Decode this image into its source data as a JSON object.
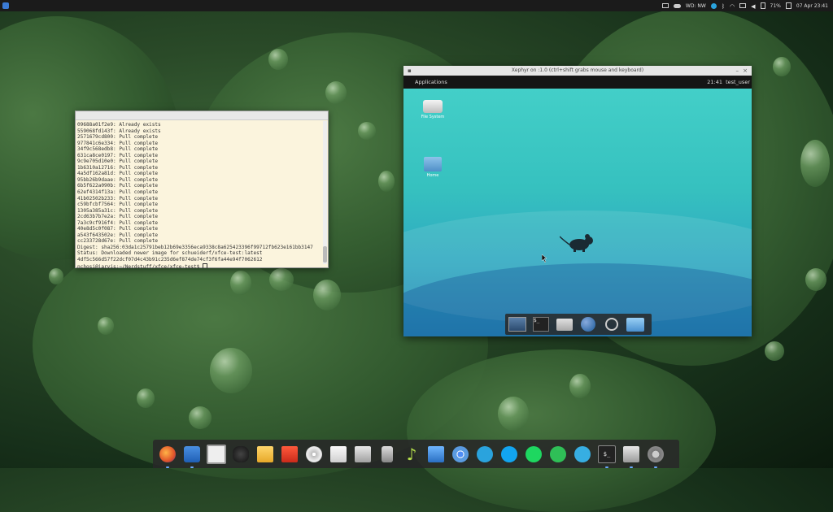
{
  "top_panel": {
    "weather": "WD: NW",
    "battery": "71%",
    "datetime": "07 Apr 23:41"
  },
  "terminal": {
    "title": "",
    "lines": [
      "09688a01f2e9: Already exists",
      "559068fd143f: Already exists",
      "2571679cd800: Pull complete",
      "977841c6e334: Pull complete",
      "34f9c568edb8: Pull complete",
      "631ca8ce0197: Pull complete",
      "9c9e705d10e0: Pull complete",
      "1b6310a12716: Pull complete",
      "4a5df162a81d: Pull complete",
      "95bb26b9daae: Pull complete",
      "6b5f622a090b: Pull complete",
      "62ef4314f13a: Pull complete",
      "41b02502b233: Pull complete",
      "c59bfcbf7564: Pull complete",
      "1305a385a31c: Pull complete",
      "2cd63b7b7e2a: Pull complete",
      "7a3c9cf916f4: Pull complete",
      "40e8d5c0f087: Pull complete",
      "a543f643502e: Pull complete",
      "cc233728d67e: Pull complete",
      "Digest: sha256:03da1c25791beb12b69e3356eca9338c8a625423396f99712fb623e161bb3147",
      "Status: Downloaded newer image for schueiderf/xfce-test:latest",
      "4df5c566d57f22dcf07d4c43b91c235d6ef874de74cf3f6fa44e94f7062612",
      "nchosi@jarvis:~/Nerdstuff/xfce/xfce-test$ "
    ]
  },
  "xephyr": {
    "title": "Xephyr on :1.0 (ctrl+shift grabs mouse and keyboard)",
    "panel": {
      "applications": "Applications",
      "clock": "21:41",
      "user": "test_user"
    },
    "desktop_icons": [
      {
        "label": "File System",
        "icon": "drive-icon"
      },
      {
        "label": "Home",
        "icon": "home-folder-icon"
      }
    ]
  },
  "dock_apps": [
    "firefox-icon",
    "mail-icon",
    "window-icon",
    "remmina-icon",
    "envelope-icon",
    "office-icon",
    "disc-icon",
    "text-editor-icon",
    "home-folder-icon",
    "phone-icon",
    "music-note-icon",
    "system-monitor-icon",
    "chromium-icon",
    "telegram-icon",
    "skype-icon",
    "spotify-icon",
    "whatsapp-icon",
    "telegram-alt-icon",
    "terminal-icon",
    "folder-icon",
    "settings-icon"
  ],
  "colors": {
    "terminal_bg": "#fbf4dd",
    "xephyr_desktop": "#36c1bf",
    "accent": "#3b7bd6"
  }
}
